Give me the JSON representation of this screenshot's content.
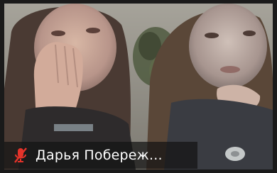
{
  "participant": {
    "name": "Дарья Побереж...",
    "muted": true,
    "mute_icon": "microphone-muted-icon"
  },
  "colors": {
    "mute_icon": "#e5332a",
    "name_text": "#ffffff",
    "tile_border": "#1a1a1a"
  }
}
